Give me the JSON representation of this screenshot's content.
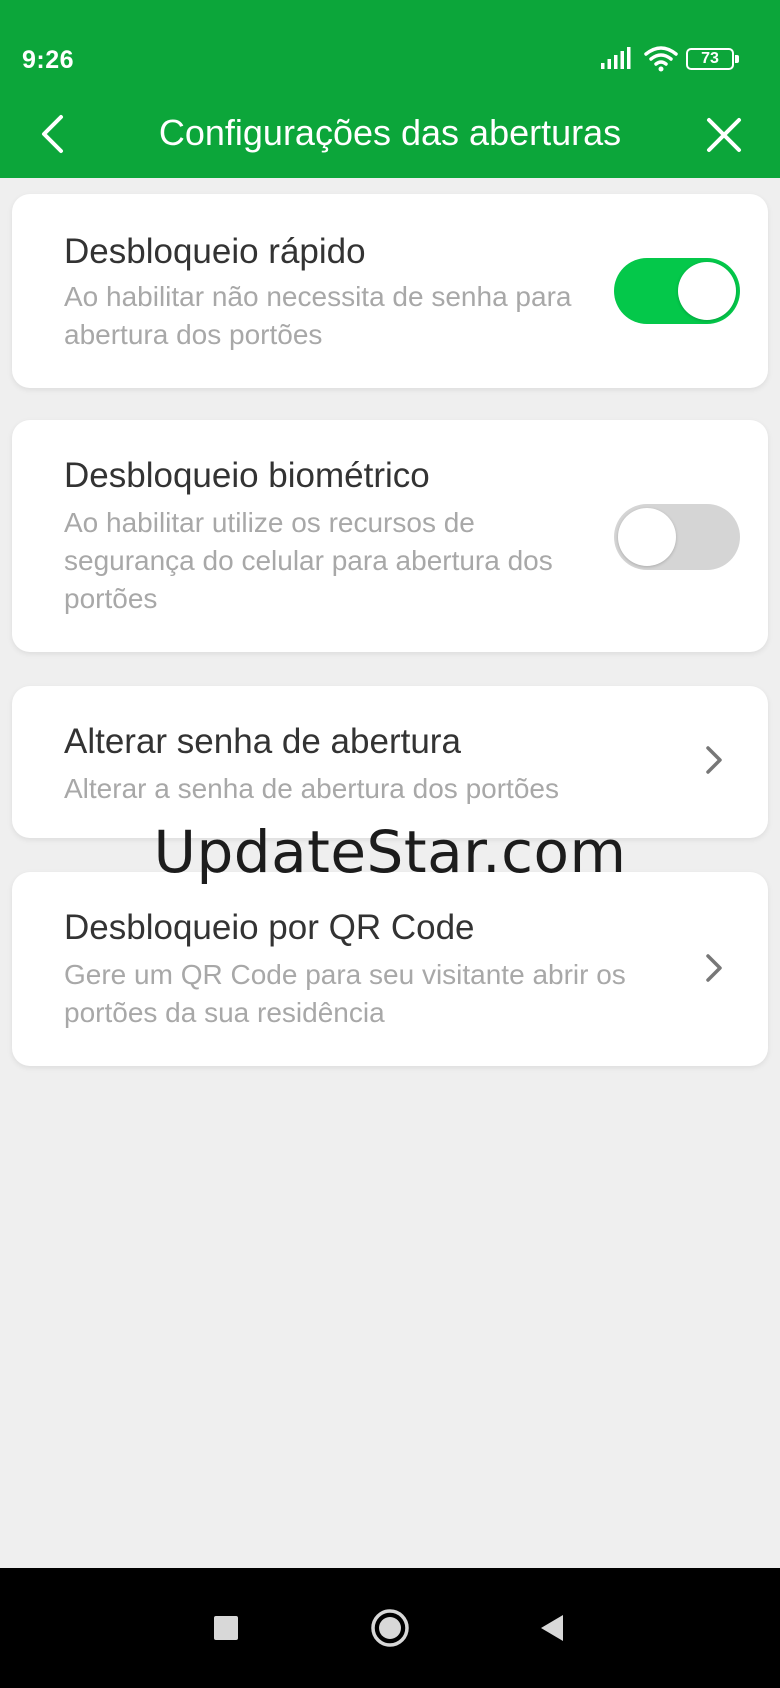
{
  "status_bar": {
    "time": "9:26",
    "battery": "73",
    "icons": [
      "signal-icon",
      "wifi-icon",
      "battery-icon"
    ]
  },
  "app_bar": {
    "title": "Configurações das aberturas",
    "back_icon": "chevron-left-icon",
    "close_icon": "close-icon"
  },
  "settings": {
    "quick_unlock": {
      "title": "Desbloqueio rápido",
      "description": "Ao habilitar não necessita de senha para abertura dos portões",
      "enabled": true
    },
    "biometric_unlock": {
      "title": "Desbloqueio biométrico",
      "description": "Ao habilitar utilize os recursos de segurança do celular para abertura dos portões",
      "enabled": false
    },
    "change_password": {
      "title": "Alterar senha de abertura",
      "description": "Alterar a senha de abertura dos portões"
    },
    "qr_unlock": {
      "title": "Desbloqueio por QR Code",
      "description": "Gere um QR Code para seu visitante abrir os portões da sua residência"
    }
  },
  "watermark": "UpdateStar.com",
  "colors": {
    "header": "#0ca63a",
    "toggle_on": "#04c84a",
    "toggle_off": "#d5d5d5",
    "background": "#efefef"
  },
  "nav_bar": {
    "icons": [
      "recents-square-icon",
      "home-circle-icon",
      "back-triangle-icon"
    ]
  }
}
